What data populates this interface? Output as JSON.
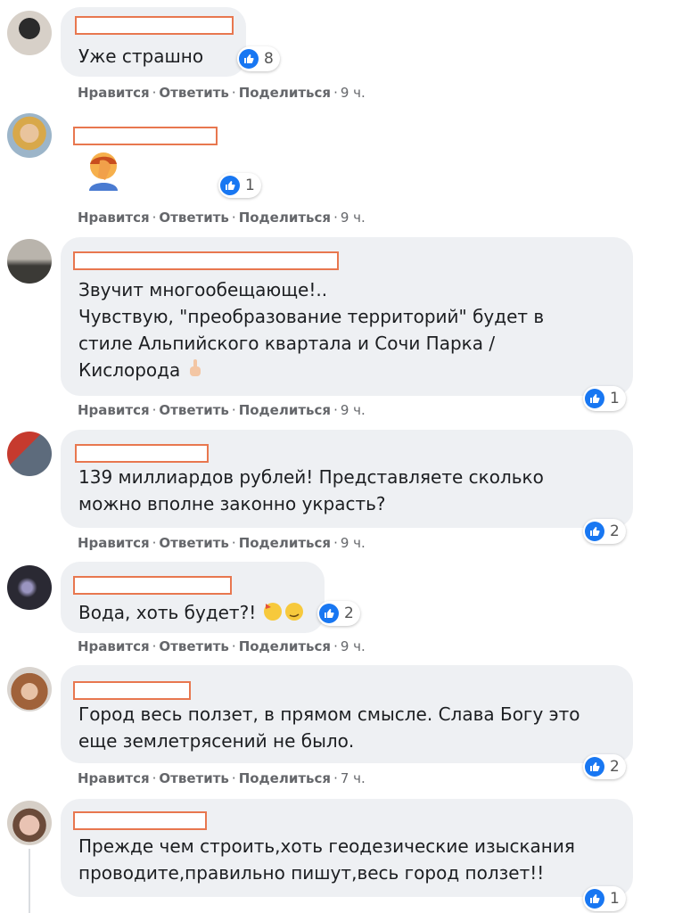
{
  "actions": {
    "like": "Нравится",
    "reply": "Ответить",
    "share": "Поделиться",
    "sep": "·"
  },
  "comments": [
    {
      "text_lines": [
        "Уже страшно"
      ],
      "likes": "8",
      "time": "9 ч."
    },
    {
      "text_lines": [],
      "emoji": "facepalm-emoji",
      "likes": "1",
      "time": "9 ч."
    },
    {
      "text_lines": [
        "Звучит многообещающе!..",
        "Чувствую, \"преобразование территорий\" будет в",
        "стиле Альпийского квартала и Сочи Парка /",
        "Кислорода"
      ],
      "emoji": "pointing-up-emoji",
      "likes": "1",
      "time": "9 ч."
    },
    {
      "text_lines": [
        "139 миллиардов рублей! Представляете сколько",
        "можно вполне законно украсть?"
      ],
      "likes": "2",
      "time": "9 ч."
    },
    {
      "text_lines": [
        "Вода, хоть будет?!"
      ],
      "emoji": "party-and-smirk-emoji",
      "likes": "2",
      "time": "9 ч."
    },
    {
      "text_lines": [
        "Город весь ползет, в прямом смысле. Слава Богу это",
        "еще землетрясений не было."
      ],
      "likes": "2",
      "time": "7 ч."
    },
    {
      "text_lines": [
        "Прежде чем строить,хоть геодезические изыскания",
        "проводите,правильно пишут,весь город ползет!!"
      ],
      "likes": "1",
      "time": ""
    }
  ],
  "colors": {
    "like_blue": "#1877f2",
    "bubble": "#eef0f3",
    "name_redaction_border": "#e8774f"
  }
}
